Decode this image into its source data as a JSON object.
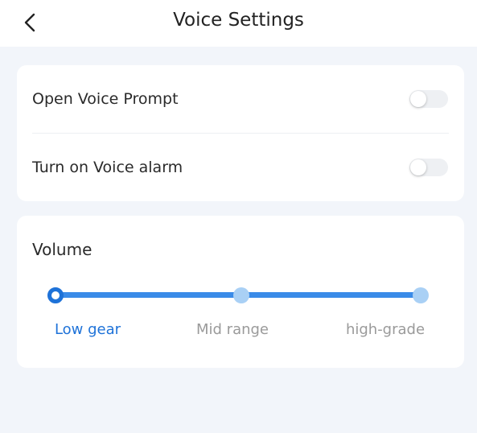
{
  "header": {
    "title": "Voice Settings"
  },
  "settings": [
    {
      "label": "Open Voice Prompt",
      "enabled": false
    },
    {
      "label": "Turn on Voice alarm",
      "enabled": false
    }
  ],
  "volume": {
    "title": "Volume",
    "levels": [
      "Low gear",
      "Mid range",
      "high-grade"
    ],
    "selected_index": 0
  },
  "colors": {
    "accent": "#1e72d8",
    "track": "#3a8be8",
    "inactive_stop": "#a9d0f5",
    "background": "#f2f5fa"
  },
  "icons": {
    "back": "chevron-left-icon"
  }
}
